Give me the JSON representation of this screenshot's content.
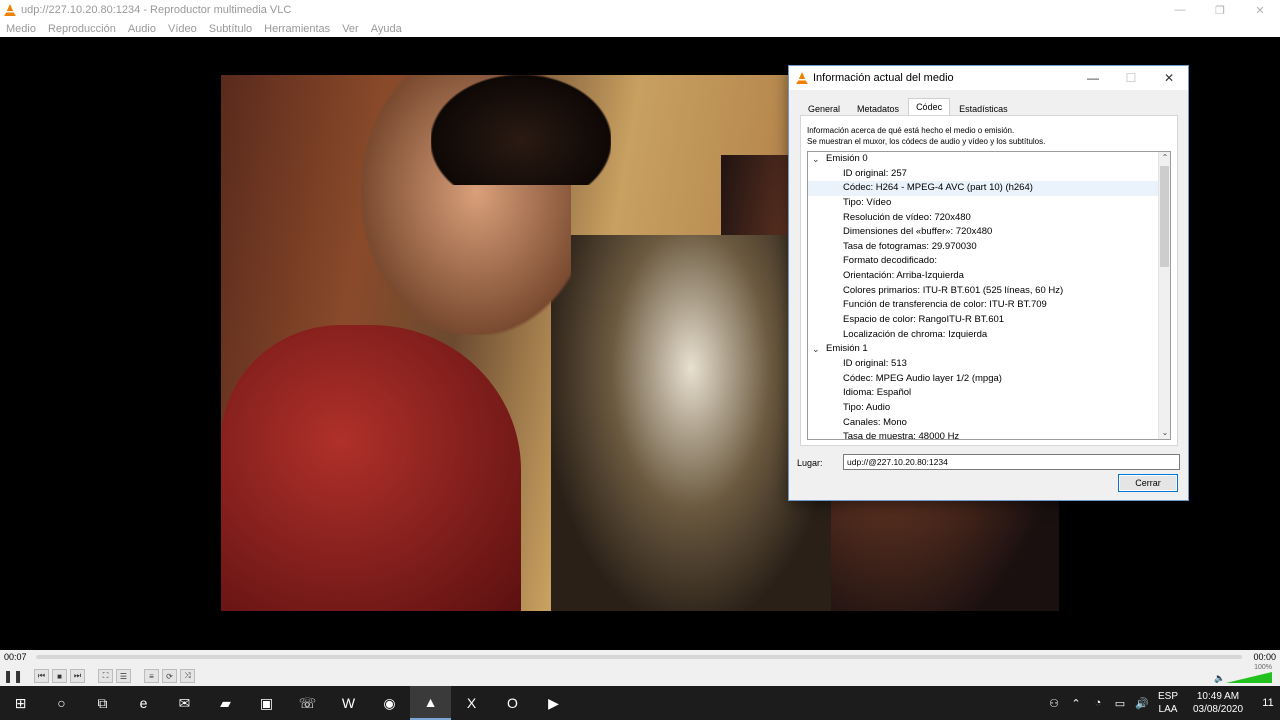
{
  "window": {
    "title": "udp://227.10.20.80:1234 - Reproductor multimedia VLC",
    "minimize": "—",
    "maximize": "❐",
    "close": "✕"
  },
  "menu": [
    "Medio",
    "Reproducción",
    "Audio",
    "Vídeo",
    "Subtítulo",
    "Herramientas",
    "Ver",
    "Ayuda"
  ],
  "player": {
    "elapsed": "00:07",
    "total": "00:00",
    "volume": "100%",
    "volume_level": 1.0
  },
  "dialog": {
    "title": "Información actual del medio",
    "tabs": [
      "General",
      "Metadatos",
      "Códec",
      "Estadísticas"
    ],
    "active_tab": "Códec",
    "description_line1": "Información acerca de qué está hecho el medio o emisión.",
    "description_line2": "Se muestran el muxor, los códecs de audio y vídeo y los subtítulos.",
    "tree": [
      {
        "type": "group",
        "text": "Emisión 0"
      },
      {
        "type": "leaf",
        "text": "ID original: 257"
      },
      {
        "type": "leaf",
        "text": "Códec: H264 - MPEG-4 AVC (part 10) (h264)",
        "hover": true
      },
      {
        "type": "leaf",
        "text": "Tipo: Vídeo"
      },
      {
        "type": "leaf",
        "text": "Resolución de vídeo: 720x480"
      },
      {
        "type": "leaf",
        "text": "Dimensiones del «buffer»: 720x480"
      },
      {
        "type": "leaf",
        "text": "Tasa de fotogramas: 29.970030"
      },
      {
        "type": "leaf",
        "text": "Formato decodificado:"
      },
      {
        "type": "leaf",
        "text": "Orientación: Arriba-Izquierda"
      },
      {
        "type": "leaf",
        "text": "Colores primarios: ITU-R BT.601 (525 líneas, 60 Hz)"
      },
      {
        "type": "leaf",
        "text": "Función de transferencia de color: ITU-R BT.709"
      },
      {
        "type": "leaf",
        "text": "Espacio de color: RangoITU-R BT.601"
      },
      {
        "type": "leaf",
        "text": "Localización de chroma: Izquierda"
      },
      {
        "type": "group",
        "text": "Emisión 1"
      },
      {
        "type": "leaf",
        "text": "ID original: 513"
      },
      {
        "type": "leaf",
        "text": "Códec: MPEG Audio layer 1/2 (mpga)"
      },
      {
        "type": "leaf",
        "text": "Idioma: Español"
      },
      {
        "type": "leaf",
        "text": "Tipo: Audio"
      },
      {
        "type": "leaf",
        "text": "Canales: Mono"
      },
      {
        "type": "leaf",
        "text": "Tasa de muestra: 48000 Hz"
      }
    ],
    "location_label": "Lugar:",
    "location_value": "udp://@227.10.20.80:1234",
    "close_button": "Cerrar"
  },
  "taskbar": {
    "apps": [
      {
        "icon": "windows-start-icon",
        "glyph": "⊞"
      },
      {
        "icon": "cortana-icon",
        "glyph": "○"
      },
      {
        "icon": "task-view-icon",
        "glyph": "⧉"
      },
      {
        "icon": "edge-icon",
        "glyph": "e"
      },
      {
        "icon": "mail-icon",
        "glyph": "✉"
      },
      {
        "icon": "file-explorer-icon",
        "glyph": "▰"
      },
      {
        "icon": "store-icon",
        "glyph": "▣"
      },
      {
        "icon": "phone-app-icon",
        "glyph": "☏"
      },
      {
        "icon": "word-icon",
        "glyph": "W"
      },
      {
        "icon": "chrome-icon",
        "glyph": "◉"
      },
      {
        "icon": "vlc-icon",
        "glyph": "▲",
        "active": true
      },
      {
        "icon": "excel-icon",
        "glyph": "X"
      },
      {
        "icon": "outlook-icon",
        "glyph": "O"
      },
      {
        "icon": "media-app-icon",
        "glyph": "▶"
      }
    ],
    "language_top": "ESP",
    "language_bottom": "LAA",
    "time": "10:49 AM",
    "date": "03/08/2020",
    "notification_count": "11"
  },
  "colors": {
    "accent": "#0078d7",
    "vlc_orange": "#f08000",
    "taskbar": "#1c1c1c"
  }
}
